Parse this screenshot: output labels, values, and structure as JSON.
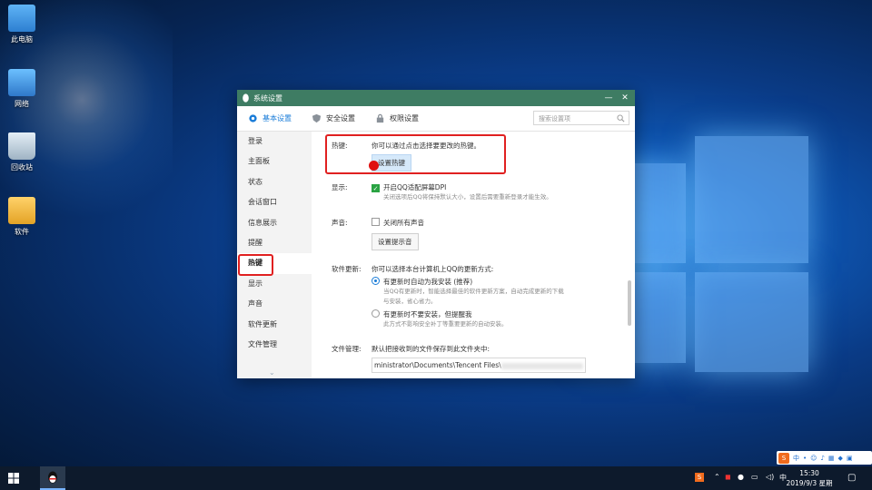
{
  "desktop": {
    "icons": [
      {
        "name": "computer",
        "label": "此电脑"
      },
      {
        "name": "network",
        "label": "网络"
      },
      {
        "name": "recycle-bin",
        "label": "回收站"
      },
      {
        "name": "software",
        "label": "软件"
      }
    ]
  },
  "dialog": {
    "title": "系统设置",
    "tabs": [
      {
        "label": "基本设置",
        "icon": "gear-icon"
      },
      {
        "label": "安全设置",
        "icon": "shield-icon"
      },
      {
        "label": "权限设置",
        "icon": "lock-icon"
      }
    ],
    "search_placeholder": "搜索设置项",
    "sidebar": [
      "登录",
      "主面板",
      "状态",
      "会话窗口",
      "信息展示",
      "提醒",
      "热键",
      "显示",
      "声音",
      "软件更新",
      "文件管理"
    ],
    "sidebar_active": "热键",
    "sections": {
      "hotkey": {
        "label": "热键:",
        "desc": "你可以通过点击选择要更改的热键。",
        "button": "设置热键"
      },
      "display": {
        "label": "显示:",
        "check": "开启QQ适配屏幕DPI",
        "hint": "关闭选项后QQ将保持默认大小，设置后需要重新登录才能生效。"
      },
      "sound": {
        "label": "声音:",
        "check": "关闭所有声音",
        "button": "设置提示音"
      },
      "update": {
        "label": "软件更新:",
        "desc": "你可以选择本台计算机上QQ的更新方式:",
        "option1": "有更新时自动为我安装 (推荐)",
        "option1_hint1": "当QQ有更新时，智能选择最佳的软件更新方案，自动完成更新的下载",
        "option1_hint2": "与安装，省心省力。",
        "option2": "有更新时不要安装，但提醒我",
        "option2_hint": "此方式不影响安全补丁等重要更新的自动安装。"
      },
      "files": {
        "label": "文件管理:",
        "desc": "默认把接收到的文件保存到此文件夹中:",
        "path": "ministrator\\Documents\\Tencent Files\\"
      }
    }
  },
  "taskbar": {
    "time": "15:30",
    "date": "2019/9/3 星期二",
    "ime_label": "中",
    "colors": {
      "bar": "#0d1a2c",
      "accent": "#3e7c63",
      "highlight": "#e02020"
    }
  }
}
